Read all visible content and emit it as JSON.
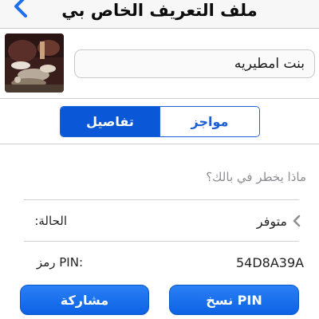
{
  "navbar": {
    "title": "ملف التعريف الخاص بي",
    "back_icon": "chevron-left-icon"
  },
  "profile": {
    "display_name": "بنت امطيريه"
  },
  "tabs": {
    "details": "تفاصيل",
    "brief": "مواجز",
    "selected": "details"
  },
  "status_message": {
    "placeholder": "ماذا يخطر في بالك؟"
  },
  "availability": {
    "label": "الحالة:",
    "value": "متوفر"
  },
  "pin": {
    "label": "رمز PIN:",
    "value": "54D8A39A"
  },
  "buttons": {
    "share": "مشاركة",
    "copy_pin": "نسخ PIN"
  },
  "colors": {
    "accent": "#0a57d8",
    "navbar_bg": "#f7f7f7",
    "separator": "#cfcfd3"
  }
}
